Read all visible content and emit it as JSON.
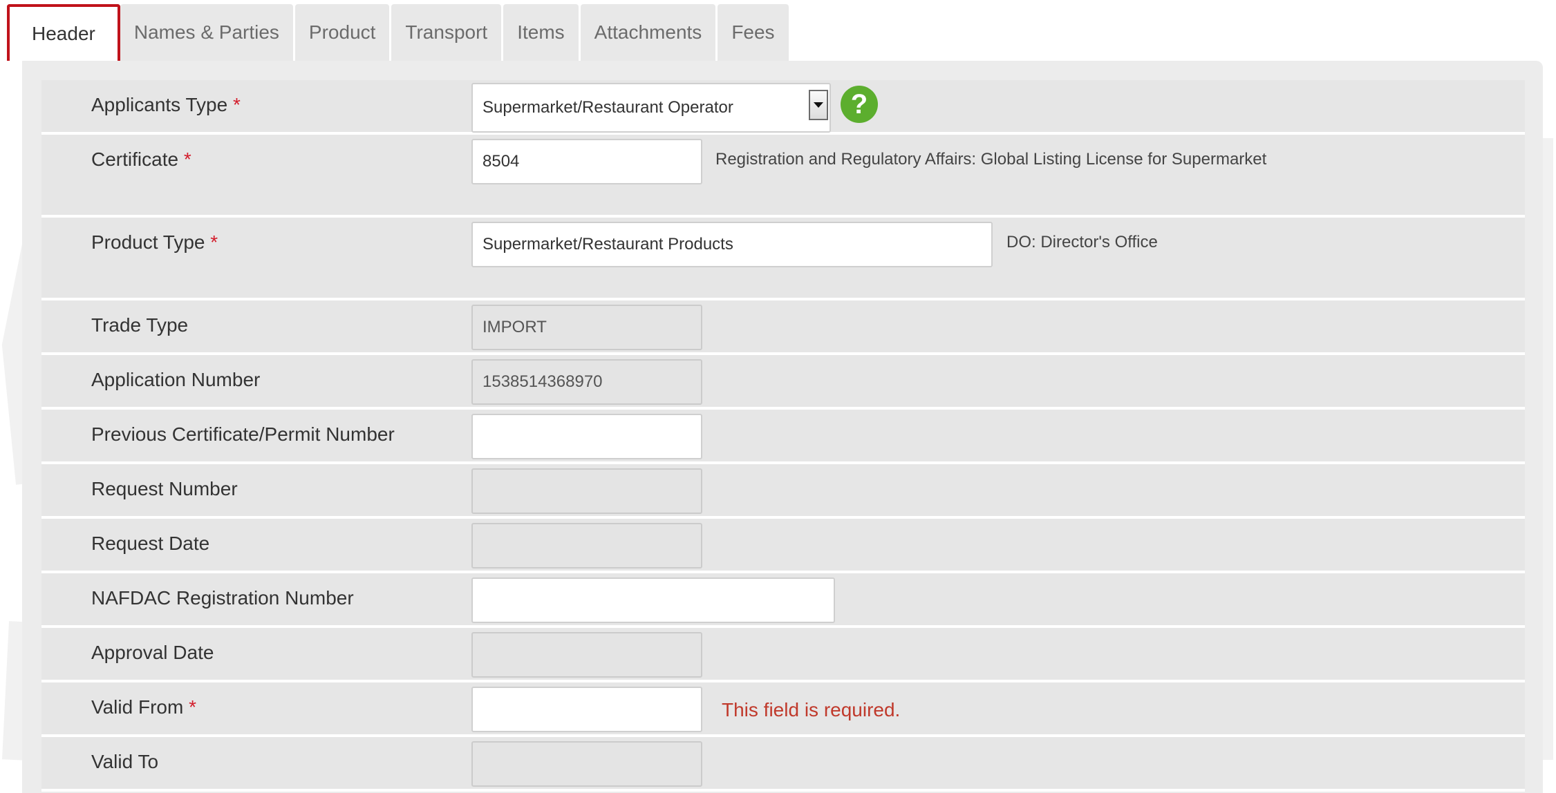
{
  "tabs": [
    {
      "label": "Header",
      "active": true
    },
    {
      "label": "Names & Parties",
      "active": false
    },
    {
      "label": "Product",
      "active": false
    },
    {
      "label": "Transport",
      "active": false
    },
    {
      "label": "Items",
      "active": false
    },
    {
      "label": "Attachments",
      "active": false
    },
    {
      "label": "Fees",
      "active": false
    }
  ],
  "required_mark": "*",
  "form": {
    "applicants_type": {
      "label": "Applicants Type",
      "value": "Supermarket/Restaurant Operator",
      "help_glyph": "?"
    },
    "certificate": {
      "label": "Certificate",
      "value": "8504",
      "description": "Registration and Regulatory Affairs: Global Listing License for Supermarket"
    },
    "product_type": {
      "label": "Product Type",
      "value": "Supermarket/Restaurant Products",
      "description": "DO: Director's Office"
    },
    "trade_type": {
      "label": "Trade Type",
      "value": "IMPORT"
    },
    "application_number": {
      "label": "Application Number",
      "value": "1538514368970"
    },
    "previous_certificate": {
      "label": "Previous Certificate/Permit Number",
      "value": ""
    },
    "request_number": {
      "label": "Request Number",
      "value": ""
    },
    "request_date": {
      "label": "Request Date",
      "value": ""
    },
    "nafdac_registration": {
      "label": "NAFDAC Registration Number",
      "value": ""
    },
    "approval_date": {
      "label": "Approval Date",
      "value": ""
    },
    "valid_from": {
      "label": "Valid From",
      "value": "",
      "error": "This field is required."
    },
    "valid_to": {
      "label": "Valid To",
      "value": ""
    }
  },
  "colors": {
    "accent_red": "#c0121b",
    "required": "#d31d2c",
    "help_green": "#5cae2e",
    "error": "#c0392b"
  }
}
